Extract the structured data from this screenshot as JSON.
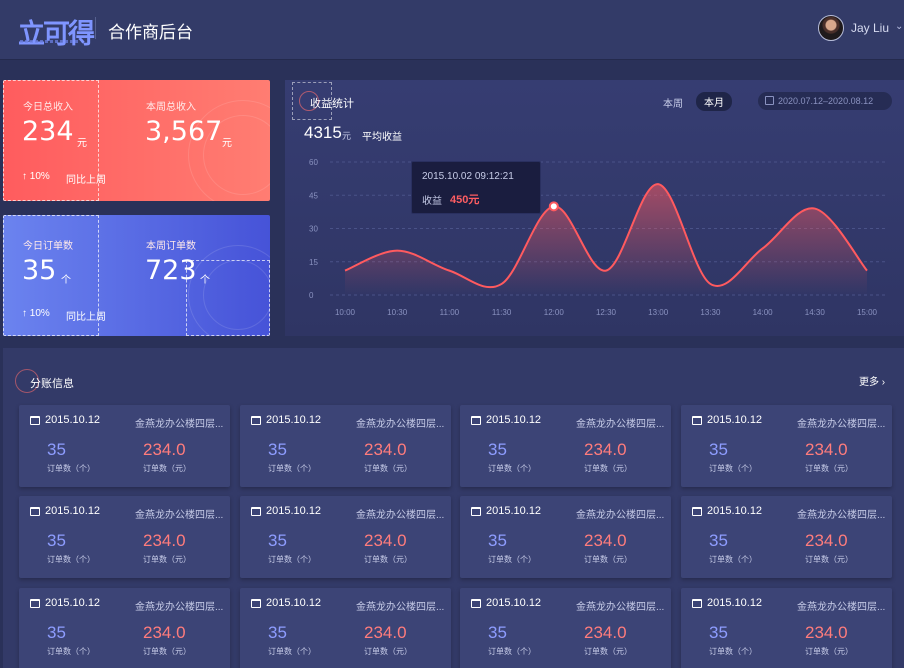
{
  "header": {
    "logo_text": "立可得",
    "system_title": "合作商后台",
    "user_name": "Jay Liu",
    "caret": "⌄"
  },
  "cards": {
    "income": {
      "today_label": "今日总收入",
      "today_value": "234",
      "today_unit": "元",
      "week_label": "本周总收入",
      "week_value": "3,567",
      "week_unit": "元",
      "change": "↑ 10%",
      "change_label": "同比上周"
    },
    "orders": {
      "today_label": "今日订单数",
      "today_value": "35",
      "today_unit": "个",
      "week_label": "本周订单数",
      "week_value": "723",
      "week_unit": "个",
      "change": "↑ 10%",
      "change_label": "同比上周"
    }
  },
  "revenue_panel": {
    "title": "收益统计",
    "toggle_week": "本周",
    "toggle_month": "本月",
    "date_range": "2020.07.12–2020.08.12",
    "avg_value": "4315",
    "avg_unit": "元",
    "avg_label": "平均收益",
    "tooltip": {
      "time": "2015.10.02  09:12:21",
      "label": "收益",
      "value": "450元"
    }
  },
  "chart_data": {
    "type": "line",
    "x": [
      "10:00",
      "10:30",
      "11:00",
      "11:30",
      "12:00",
      "12:30",
      "13:00",
      "13:30",
      "14:00",
      "14:30",
      "15:00"
    ],
    "series": [
      {
        "values": [
          11,
          20,
          11,
          5,
          40,
          11,
          50,
          5,
          21,
          39,
          11
        ]
      }
    ],
    "yticks": [
      0,
      15,
      30,
      45,
      60
    ],
    "ylim": [
      0,
      60
    ],
    "grid": true,
    "line_color": "#ff5a5f",
    "highlight_index": 4
  },
  "split_panel": {
    "title": "分账信息",
    "more": "更多 ›",
    "tiles": [
      {
        "date": "2015.10.12",
        "location": "金燕龙办公楼四层...",
        "count": "35",
        "count_label": "订单数（个）",
        "amount": "234.0",
        "amount_label": "订单数（元）"
      },
      {
        "date": "2015.10.12",
        "location": "金燕龙办公楼四层...",
        "count": "35",
        "count_label": "订单数（个）",
        "amount": "234.0",
        "amount_label": "订单数（元）"
      },
      {
        "date": "2015.10.12",
        "location": "金燕龙办公楼四层...",
        "count": "35",
        "count_label": "订单数（个）",
        "amount": "234.0",
        "amount_label": "订单数（元）"
      },
      {
        "date": "2015.10.12",
        "location": "金燕龙办公楼四层...",
        "count": "35",
        "count_label": "订单数（个）",
        "amount": "234.0",
        "amount_label": "订单数（元）"
      },
      {
        "date": "2015.10.12",
        "location": "金燕龙办公楼四层...",
        "count": "35",
        "count_label": "订单数（个）",
        "amount": "234.0",
        "amount_label": "订单数（元）"
      },
      {
        "date": "2015.10.12",
        "location": "金燕龙办公楼四层...",
        "count": "35",
        "count_label": "订单数（个）",
        "amount": "234.0",
        "amount_label": "订单数（元）"
      },
      {
        "date": "2015.10.12",
        "location": "金燕龙办公楼四层...",
        "count": "35",
        "count_label": "订单数（个）",
        "amount": "234.0",
        "amount_label": "订单数（元）"
      },
      {
        "date": "2015.10.12",
        "location": "金燕龙办公楼四层...",
        "count": "35",
        "count_label": "订单数（个）",
        "amount": "234.0",
        "amount_label": "订单数（元）"
      },
      {
        "date": "2015.10.12",
        "location": "金燕龙办公楼四层...",
        "count": "35",
        "count_label": "订单数（个）",
        "amount": "234.0",
        "amount_label": "订单数（元）"
      },
      {
        "date": "2015.10.12",
        "location": "金燕龙办公楼四层...",
        "count": "35",
        "count_label": "订单数（个）",
        "amount": "234.0",
        "amount_label": "订单数（元）"
      },
      {
        "date": "2015.10.12",
        "location": "金燕龙办公楼四层...",
        "count": "35",
        "count_label": "订单数（个）",
        "amount": "234.0",
        "amount_label": "订单数（元）"
      },
      {
        "date": "2015.10.12",
        "location": "金燕龙办公楼四层...",
        "count": "35",
        "count_label": "订单数（个）",
        "amount": "234.0",
        "amount_label": "订单数（元）"
      }
    ]
  },
  "colors": {
    "background": "#2a3159",
    "income_card": "#ff5c5e",
    "orders_card": "#4653d8",
    "count_value": "#8e9dff",
    "amount_value": "#ff7c7c"
  }
}
